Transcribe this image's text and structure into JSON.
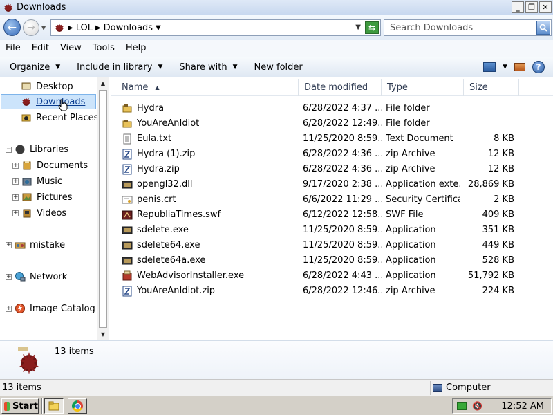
{
  "window": {
    "title": "Downloads"
  },
  "address": {
    "breadcrumbs": [
      "LOL",
      "Downloads"
    ],
    "search_placeholder": "Search Downloads"
  },
  "menu": [
    "File",
    "Edit",
    "View",
    "Tools",
    "Help"
  ],
  "commands": {
    "organize": "Organize",
    "include_in_library": "Include in library",
    "share_with": "Share with",
    "new_folder": "New folder"
  },
  "nav": {
    "desktop": "Desktop",
    "downloads": "Downloads",
    "recent_places": "Recent Places",
    "libraries": "Libraries",
    "documents": "Documents",
    "music": "Music",
    "pictures": "Pictures",
    "videos": "Videos",
    "mistake": "mistake",
    "network": "Network",
    "image_catalog": "Image Catalog"
  },
  "columns": {
    "name": "Name",
    "date": "Date modified",
    "type": "Type",
    "size": "Size"
  },
  "files": [
    {
      "name": "Hydra",
      "date": "6/28/2022 4:37 ...",
      "type": "File folder",
      "size": "",
      "icon": "folder-icon"
    },
    {
      "name": "YouAreAnIdiot",
      "date": "6/28/2022 12:49...",
      "type": "File folder",
      "size": "",
      "icon": "folder-icon"
    },
    {
      "name": "Eula.txt",
      "date": "11/25/2020 8:59...",
      "type": "Text Document",
      "size": "8 KB",
      "icon": "text-file-icon"
    },
    {
      "name": "Hydra (1).zip",
      "date": "6/28/2022 4:36 ...",
      "type": "zip Archive",
      "size": "12 KB",
      "icon": "zip-icon"
    },
    {
      "name": "Hydra.zip",
      "date": "6/28/2022 4:36 ...",
      "type": "zip Archive",
      "size": "12 KB",
      "icon": "zip-icon"
    },
    {
      "name": "opengl32.dll",
      "date": "9/17/2020 2:38 ...",
      "type": "Application exte...",
      "size": "28,869 KB",
      "icon": "dll-icon"
    },
    {
      "name": "penis.crt",
      "date": "6/6/2022 11:29 ...",
      "type": "Security Certifica...",
      "size": "2 KB",
      "icon": "certificate-icon"
    },
    {
      "name": "RepubliaTimes.swf",
      "date": "6/12/2022 12:58...",
      "type": "SWF File",
      "size": "409 KB",
      "icon": "swf-icon"
    },
    {
      "name": "sdelete.exe",
      "date": "11/25/2020 8:59...",
      "type": "Application",
      "size": "351 KB",
      "icon": "exe-icon"
    },
    {
      "name": "sdelete64.exe",
      "date": "11/25/2020 8:59...",
      "type": "Application",
      "size": "449 KB",
      "icon": "exe-icon"
    },
    {
      "name": "sdelete64a.exe",
      "date": "11/25/2020 8:59...",
      "type": "Application",
      "size": "528 KB",
      "icon": "exe-icon"
    },
    {
      "name": "WebAdvisorInstaller.exe",
      "date": "6/28/2022 4:43 ...",
      "type": "Application",
      "size": "51,792 KB",
      "icon": "installer-icon"
    },
    {
      "name": "YouAreAnIdiot.zip",
      "date": "6/28/2022 12:46...",
      "type": "zip Archive",
      "size": "224 KB",
      "icon": "zip-icon"
    }
  ],
  "details": {
    "count": "13 items"
  },
  "status": {
    "items": "13 items",
    "zone": "Computer"
  },
  "taskbar": {
    "start": "Start",
    "clock": "12:52 AM"
  },
  "colors": {
    "selection": "#cce4fb",
    "selection_border": "#7eb4ea",
    "accent": "#3368b8"
  }
}
